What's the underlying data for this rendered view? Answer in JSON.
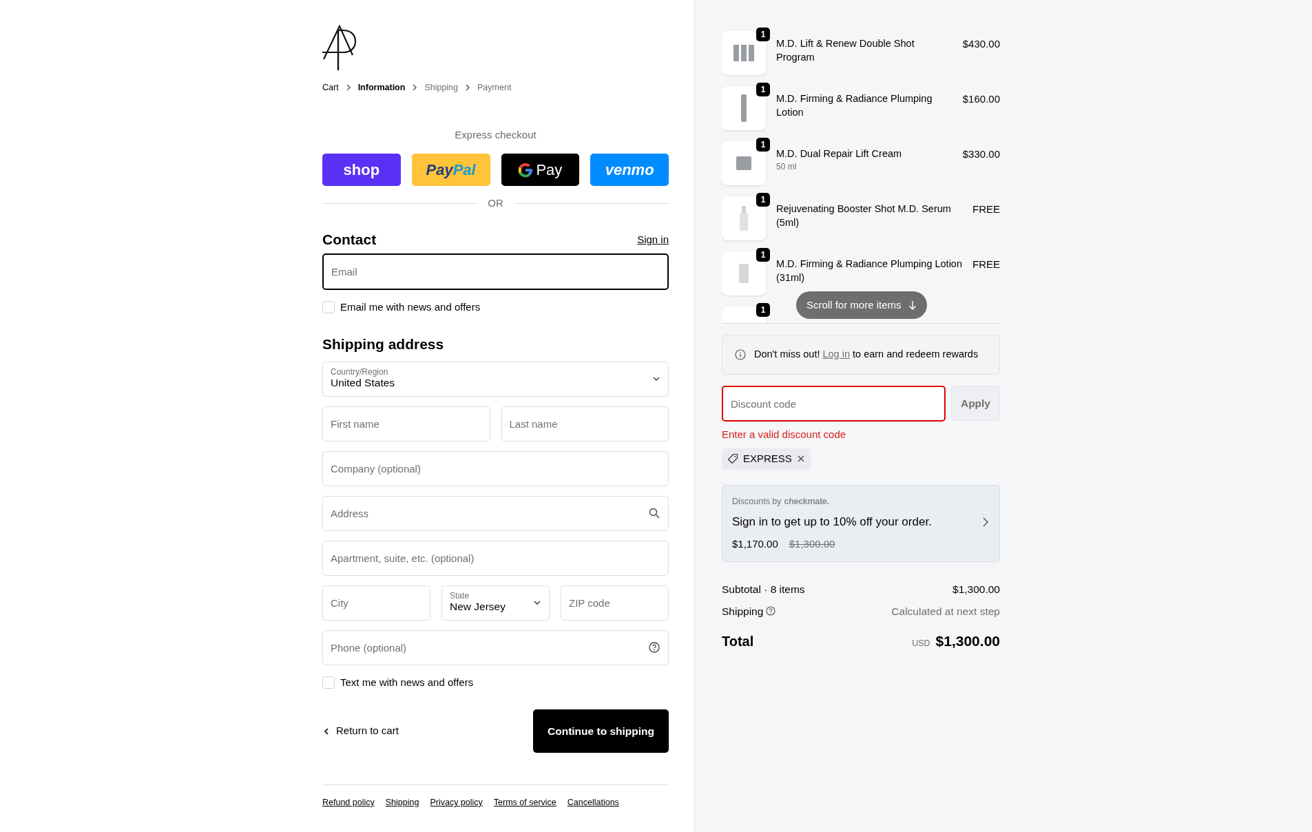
{
  "breadcrumb": [
    {
      "label": "Cart",
      "selected": false,
      "visited": true
    },
    {
      "label": "Information",
      "selected": true,
      "visited": true
    },
    {
      "label": "Shipping",
      "selected": false,
      "visited": false
    },
    {
      "label": "Payment",
      "selected": false,
      "visited": false
    }
  ],
  "express": {
    "title": "Express checkout",
    "divider": "OR",
    "buttons": [
      {
        "kind": "shop",
        "label_parts": [
          "shop"
        ]
      },
      {
        "kind": "paypal",
        "label_parts": [
          "Pay",
          "Pal"
        ]
      },
      {
        "kind": "gpay",
        "label_parts": [
          "Pay"
        ]
      },
      {
        "kind": "venmo",
        "label_parts": [
          "venmo"
        ]
      }
    ]
  },
  "contact": {
    "title": "Contact",
    "sign_in": "Sign in",
    "email": {
      "placeholder": "Email",
      "focused": true
    },
    "news": {
      "label": "Email me with news and offers",
      "checked": false
    }
  },
  "shipping": {
    "title": "Shipping address",
    "rows": [
      [
        {
          "kind": "select",
          "label": "Country/Region",
          "value": "United States"
        }
      ],
      [
        {
          "kind": "input",
          "placeholder": "First name"
        },
        {
          "kind": "input",
          "placeholder": "Last name"
        }
      ],
      [
        {
          "kind": "input",
          "placeholder": "Company (optional)"
        }
      ],
      [
        {
          "kind": "search",
          "placeholder": "Address"
        }
      ],
      [
        {
          "kind": "input",
          "placeholder": "Apartment, suite, etc. (optional)"
        }
      ],
      [
        {
          "kind": "input",
          "placeholder": "City"
        },
        {
          "kind": "select",
          "label": "State",
          "value": "New Jersey"
        },
        {
          "kind": "input",
          "placeholder": "ZIP code"
        }
      ],
      [
        {
          "kind": "help",
          "placeholder": "Phone (optional)"
        }
      ]
    ],
    "sms": {
      "label": "Text me with news and offers",
      "checked": false
    }
  },
  "actions": {
    "back": "Return to cart",
    "continue": "Continue to shipping"
  },
  "footer_links": [
    "Refund policy",
    "Shipping",
    "Privacy policy",
    "Terms of service",
    "Cancellations"
  ],
  "order": {
    "scroll_hint": "Scroll for more items",
    "items": [
      {
        "quantity": "1",
        "name": "M.D. Lift & Renew Double Shot Program",
        "price": "$430.00",
        "kind": "set"
      },
      {
        "quantity": "1",
        "name": "M.D. Firming & Radiance Plumping Lotion",
        "price": "$160.00",
        "kind": "tube"
      },
      {
        "quantity": "1",
        "name": "M.D. Dual Repair Lift Cream",
        "variant": "50 ml",
        "price": "$330.00",
        "kind": "jar"
      },
      {
        "quantity": "1",
        "name": "Rejuvenating Booster Shot M.D. Serum (5ml)",
        "price": "FREE",
        "kind": "dropper"
      },
      {
        "quantity": "1",
        "name": "M.D. Firming & Radiance Plumping Lotion (31ml)",
        "price": "FREE",
        "kind": "pump"
      },
      {
        "quantity": "1"
      }
    ]
  },
  "rewards": {
    "before": "Don't miss out!",
    "link": "Log in",
    "after": "to earn and redeem rewards"
  },
  "discount": {
    "placeholder": "Discount code",
    "invalid": true,
    "button": "Apply",
    "button_disabled": true,
    "error": "Enter a valid discount code",
    "applied": [
      {
        "code": "EXPRESS"
      }
    ]
  },
  "checkmate": {
    "by": "Discounts by",
    "brand": "checkmate.",
    "message": "Sign in to get up to 10% off your order.",
    "price": "$1,170.00",
    "original_price": "$1,300.00"
  },
  "summary": {
    "subtotal_label": "Subtotal · 8 items",
    "subtotal": "$1,300.00",
    "shipping_label": "Shipping",
    "shipping": "Calculated at next step",
    "total_label": "Total",
    "currency": "USD",
    "total": "$1,300.00"
  }
}
